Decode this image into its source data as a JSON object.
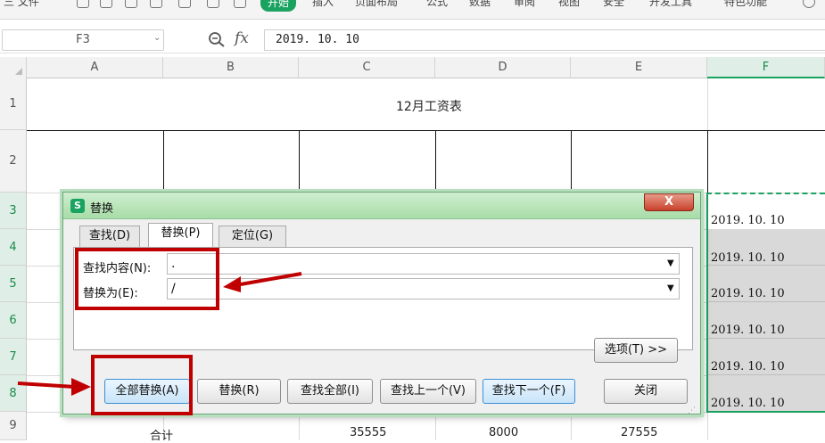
{
  "menubar": {
    "items": [
      "三 文件",
      "开始",
      "插入",
      "页面布局",
      "公式",
      "数据",
      "审阅",
      "视图",
      "安全",
      "开发工具",
      "特色功能"
    ],
    "active": "开始"
  },
  "formula_bar": {
    "name_box": "F3",
    "zoom_icon": "magnifier-icon",
    "fx_label": "fx",
    "formula": "2019. 10. 10"
  },
  "grid": {
    "columns": [
      "A",
      "B",
      "C",
      "D",
      "E",
      "F"
    ],
    "selected_column": "F",
    "rows": [
      "1",
      "2",
      "3",
      "4",
      "5",
      "6",
      "7",
      "8",
      "9"
    ],
    "title": "12月工资表",
    "f_values": [
      "2019. 10. 10",
      "2019. 10. 10",
      "2019. 10. 10",
      "2019. 10. 10",
      "2019. 10. 10",
      "2019. 10. 10"
    ],
    "total_row": {
      "label": "合计",
      "c": "35555",
      "d": "8000",
      "e": "27555"
    }
  },
  "dialog": {
    "logo": "S",
    "title": "替换",
    "close": "X",
    "tabs": [
      "查找(D)",
      "替换(P)",
      "定位(G)"
    ],
    "active_tab": "替换(P)",
    "find_label": "查找内容(N):",
    "find_value": ".",
    "replace_label": "替换为(E):",
    "replace_value": "/",
    "options_button": "选项(T) >>",
    "buttons": {
      "replace_all": "全部替换(A)",
      "replace": "替换(R)",
      "find_all": "查找全部(I)",
      "find_prev": "查找上一个(V)",
      "find_next": "查找下一个(F)",
      "close": "关闭"
    }
  },
  "colors": {
    "accent_green": "#1aa260",
    "annotation_red": "#c00000",
    "dialog_border": "#6da57a"
  }
}
